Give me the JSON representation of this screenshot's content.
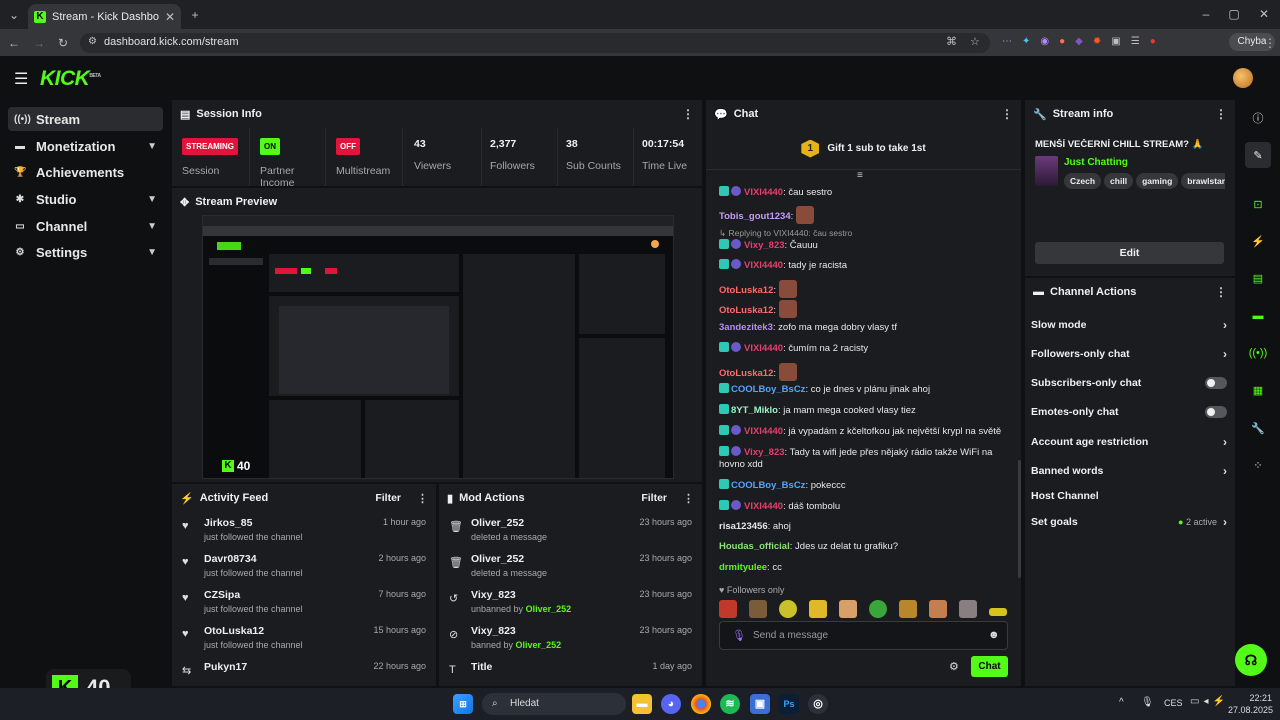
{
  "browser": {
    "tab_title": "Stream - Kick Dashboard",
    "tab_favicon": "K",
    "url": "dashboard.kick.com/stream",
    "profile_chip": "Chyba"
  },
  "app": {
    "logo": "KICK",
    "logo_sup": "BETA"
  },
  "sidebar": {
    "items": [
      {
        "label": "Stream",
        "icon": "stream-icon"
      },
      {
        "label": "Monetization",
        "icon": "monetization-icon"
      },
      {
        "label": "Achievements",
        "icon": "trophy-icon"
      },
      {
        "label": "Studio",
        "icon": "studio-icon"
      },
      {
        "label": "Channel",
        "icon": "channel-icon"
      },
      {
        "label": "Settings",
        "icon": "gear-icon"
      }
    ]
  },
  "session": {
    "title": "Session Info",
    "stats": [
      {
        "badge": "STREAMING",
        "label": "Session"
      },
      {
        "badge": "ON",
        "label": "Partner Income"
      },
      {
        "badge": "OFF",
        "label": "Multistream"
      },
      {
        "value": "43",
        "label": "Viewers"
      },
      {
        "value": "2,377",
        "label": "Followers"
      },
      {
        "value": "38",
        "label": "Sub Counts"
      },
      {
        "value": "00:17:54",
        "label": "Time Live"
      }
    ]
  },
  "preview": {
    "title": "Stream Preview",
    "viewer_count": "40"
  },
  "activity": {
    "title": "Activity Feed",
    "filter": "Filter",
    "items": [
      {
        "name": "Jirkos_85",
        "sub": "just followed the channel",
        "time": "1 hour ago"
      },
      {
        "name": "Davr08734",
        "sub": "just followed the channel",
        "time": "2 hours ago"
      },
      {
        "name": "CZSipa",
        "sub": "just followed the channel",
        "time": "7 hours ago"
      },
      {
        "name": "OtoLuska12",
        "sub": "just followed the channel",
        "time": "15 hours ago"
      },
      {
        "name": "Pukyn17",
        "sub": "",
        "time": "22 hours ago"
      }
    ]
  },
  "mod": {
    "title": "Mod Actions",
    "filter": "Filter",
    "items": [
      {
        "name": "Oliver_252",
        "sub": "deleted a message",
        "by": "",
        "time": "23 hours ago"
      },
      {
        "name": "Oliver_252",
        "sub": "deleted a message",
        "by": "",
        "time": "23 hours ago"
      },
      {
        "name": "Vixy_823",
        "sub": "unbanned by ",
        "by": "Oliver_252",
        "time": "23 hours ago"
      },
      {
        "name": "Vixy_823",
        "sub": "banned by ",
        "by": "Oliver_252",
        "time": "23 hours ago"
      },
      {
        "name": "Title",
        "sub": "",
        "by": "",
        "time": "1 day ago"
      }
    ]
  },
  "chat": {
    "title": "Chat",
    "gift": "Gift 1 sub to take 1st",
    "gift_count": "1",
    "messages": [
      {
        "user": "VIXI4440",
        "color": "#e63e6d",
        "badges": true,
        "text": "čau sestro"
      },
      {
        "user": "Tobis_gout1234",
        "color": "#c79cf9",
        "badges": false,
        "text": ""
      },
      {
        "reply": "Replying to VIXI4440: čau sestro"
      },
      {
        "user": "Vixy_823",
        "color": "#e63e6d",
        "badges": true,
        "text": "Čauuu"
      },
      {
        "user": "VIXI4440",
        "color": "#e63e6d",
        "badges": true,
        "text": "tady je racista"
      },
      {
        "user": "OtoLuska12",
        "color": "#ff6b6b",
        "badges": false,
        "text": ""
      },
      {
        "user": "OtoLuska12",
        "color": "#ff6b6b",
        "badges": false,
        "text": ""
      },
      {
        "user": "3andezitek3",
        "color": "#b48cff",
        "badges": false,
        "text": "zofo ma mega dobry vlasy tf"
      },
      {
        "user": "VIXI4440",
        "color": "#e63e6d",
        "badges": true,
        "text": "čumím na 2 racisty"
      },
      {
        "user": "OtoLuska12",
        "color": "#ff6b6b",
        "badges": false,
        "text": ""
      },
      {
        "user": "COOLBoy_BsCz",
        "color": "#53a6ff",
        "badges": true,
        "text": "co je dnes v plánu jinak ahoj"
      },
      {
        "user": "8YT_Miklo",
        "color": "#9ff0c8",
        "badges": true,
        "text": "ja mam mega cooked vlasy tiez"
      },
      {
        "user": "VIXI4440",
        "color": "#e63e6d",
        "badges": true,
        "text": "já vypadám z kčeltofkou jak největší krypl na světě"
      },
      {
        "user": "Vixy_823",
        "color": "#e63e6d",
        "badges": true,
        "text": "Tady ta wifi jede přes nějaký rádio takže WiFi na hovno xdd"
      },
      {
        "user": "COOLBoy_BsCz",
        "color": "#53a6ff",
        "badges": true,
        "text": "pokeccc"
      },
      {
        "user": "VIXI4440",
        "color": "#e63e6d",
        "badges": true,
        "text": "dáš tombolu"
      },
      {
        "user": "risa123456",
        "color": "#e6e6e6",
        "badges": false,
        "text": "ahoj"
      },
      {
        "user": "Houdas_official",
        "color": "#8be07a",
        "badges": false,
        "text": "Jdes uz delat tu grafiku?"
      },
      {
        "user": "drmityulee",
        "color": "#53fc18",
        "badges": false,
        "text": "cc"
      }
    ],
    "followers_only": "Followers only",
    "placeholder": "Send a message",
    "send": "Chat"
  },
  "stream_info": {
    "title": "Stream info",
    "stream_title": "MENŠÍ VEČERNÍ CHILL STREAM? 🙏",
    "category": "Just Chatting",
    "tags": [
      "Czech",
      "chill",
      "gaming",
      "brawlstars"
    ],
    "edit": "Edit"
  },
  "channel_actions": {
    "title": "Channel Actions",
    "items": [
      {
        "label": "Slow mode",
        "control": "chevron"
      },
      {
        "label": "Followers-only chat",
        "control": "chevron"
      },
      {
        "label": "Subscribers-only chat",
        "control": "toggle"
      },
      {
        "label": "Emotes-only chat",
        "control": "toggle"
      },
      {
        "label": "Account age restriction",
        "control": "chevron"
      },
      {
        "label": "Banned words",
        "control": "chevron"
      },
      {
        "label": "Host Channel",
        "control": "none"
      },
      {
        "label": "Set goals",
        "control": "chevron",
        "extra": "2 active"
      }
    ]
  },
  "overlay": {
    "viewers": "40"
  },
  "taskbar": {
    "search": "Hledat",
    "lang": "CES",
    "time": "22:21",
    "date": "27.08.2025"
  },
  "colors": {
    "accent": "#53fc18",
    "panel": "#1b1c1f",
    "bg": "#0f1012"
  }
}
